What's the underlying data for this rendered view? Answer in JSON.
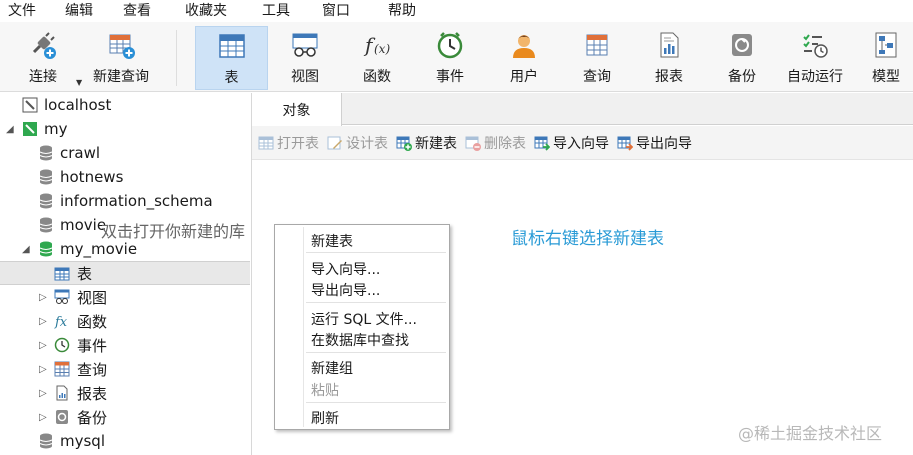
{
  "menu": [
    "文件",
    "编辑",
    "查看",
    "收藏夹",
    "工具",
    "窗口",
    "帮助"
  ],
  "toolbar": {
    "connect": "连接",
    "new_query": "新建查询",
    "items": [
      "表",
      "视图",
      "函数",
      "事件",
      "用户",
      "查询",
      "报表",
      "备份",
      "自动运行",
      "模型"
    ],
    "active": "表"
  },
  "tree": {
    "localhost": "localhost",
    "my": "my",
    "crawl": "crawl",
    "hotnews": "hotnews",
    "information_schema": "information_schema",
    "movie": "movie",
    "my_movie": "my_movie",
    "table": "表",
    "view": "视图",
    "function": "函数",
    "event": "事件",
    "query": "查询",
    "report": "报表",
    "backup": "备份",
    "mysql": "mysql"
  },
  "tab": {
    "objects": "对象"
  },
  "objbar": {
    "open_table": "打开表",
    "design_table": "设计表",
    "new_table": "新建表",
    "delete_table": "删除表",
    "import_wizard": "导入向导",
    "export_wizard": "导出向导"
  },
  "context_menu": {
    "new_table": "新建表",
    "import_wizard": "导入向导...",
    "export_wizard": "导出向导...",
    "run_sql": "运行 SQL 文件...",
    "find_in_db": "在数据库中查找",
    "new_group": "新建组",
    "paste": "粘贴",
    "refresh": "刷新"
  },
  "annotations": {
    "double_click_hint": "双击打开你新建的库",
    "right_click_hint": "鼠标右键选择新建表"
  },
  "watermark": "@稀土掘金技术社区",
  "colors": {
    "active_tab_bg": "#cfe3f7",
    "hint_blue": "#2a9bd6",
    "db_green": "#2fa84f"
  }
}
